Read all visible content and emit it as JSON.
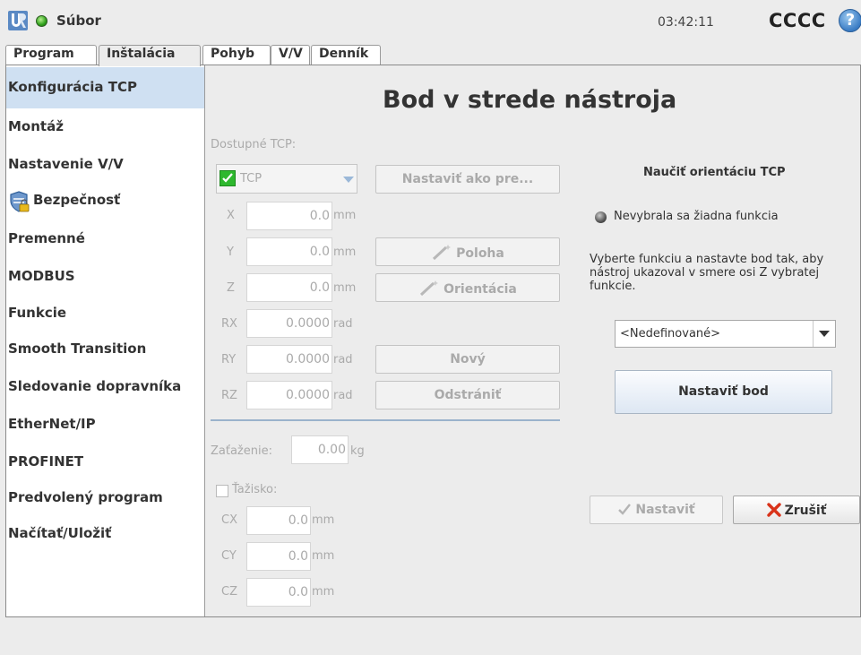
{
  "header": {
    "file_menu": "Súbor",
    "clock": "03:42:11",
    "robot_name": "CCCC",
    "help": "?"
  },
  "tabs": [
    {
      "label": "Program"
    },
    {
      "label": "Inštalácia",
      "active": true
    },
    {
      "label": "Pohyb"
    },
    {
      "label": "V/V"
    },
    {
      "label": "Denník"
    }
  ],
  "sidebar": {
    "items": [
      {
        "label": "Konfigurácia TCP",
        "selected": true
      },
      {
        "label": "Montáž"
      },
      {
        "label": "Nastavenie V/V"
      },
      {
        "label": "Bezpečnosť",
        "icon": "shield-lock-icon"
      },
      {
        "label": "Premenné"
      },
      {
        "label": "MODBUS"
      },
      {
        "label": "Funkcie"
      },
      {
        "label": "Smooth Transition"
      },
      {
        "label": "Sledovanie dopravníka"
      },
      {
        "label": "EtherNet/IP"
      },
      {
        "label": "PROFINET"
      },
      {
        "label": "Predvolený program"
      },
      {
        "label": "Načítať/Uložiť"
      }
    ]
  },
  "main": {
    "title": "Bod v strede nástroja",
    "available_tcp_label": "Dostupné TCP:",
    "tcp_selected": "TCP",
    "set_default_button": "Nastaviť ako pre...",
    "position_button": "Poloha",
    "orientation_button": "Orientácia",
    "new_button": "Nový",
    "remove_button": "Odstrániť",
    "coords": [
      {
        "label": "X",
        "value": "0.0",
        "unit": "mm"
      },
      {
        "label": "Y",
        "value": "0.0",
        "unit": "mm"
      },
      {
        "label": "Z",
        "value": "0.0",
        "unit": "mm"
      },
      {
        "label": "RX",
        "value": "0.0000",
        "unit": "rad"
      },
      {
        "label": "RY",
        "value": "0.0000",
        "unit": "rad"
      },
      {
        "label": "RZ",
        "value": "0.0000",
        "unit": "rad"
      }
    ],
    "payload_label": "Zaťaženie:",
    "payload_value": "0.00",
    "payload_unit": "kg",
    "cog_label": "Ťažisko:",
    "cog": [
      {
        "label": "CX",
        "value": "0.0",
        "unit": "mm"
      },
      {
        "label": "CY",
        "value": "0.0",
        "unit": "mm"
      },
      {
        "label": "CZ",
        "value": "0.0",
        "unit": "mm"
      }
    ]
  },
  "teach": {
    "title": "Naučiť orientáciu TCP",
    "status": "Nevybrala sa žiadna funkcia",
    "instructions": "Vyberte funkciu a nastavte bod tak, aby nástroj ukazoval v smere osi Z vybratej funkcie.",
    "feature_value": "<Nedefinované>",
    "set_point_button": "Nastaviť bod",
    "apply_button": "Nastaviť",
    "cancel_button": "Zrušiť"
  },
  "colors": {
    "selected_sidebar": "#cfe0f2",
    "checkbox_green": "#2eb82e",
    "cancel_icon": "#d9331a"
  }
}
